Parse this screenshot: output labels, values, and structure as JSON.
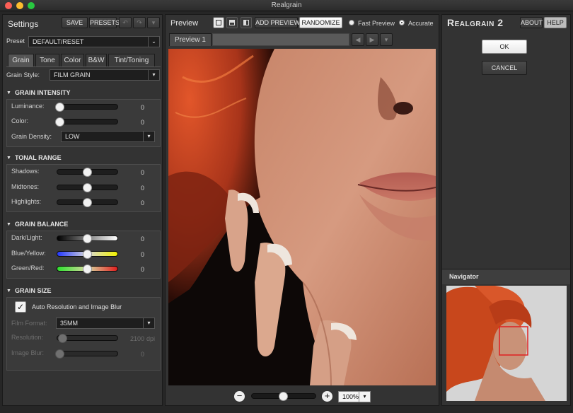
{
  "window": {
    "title": "Realgrain"
  },
  "left": {
    "title": "Settings",
    "save": "SAVE",
    "presets": "PRESETS",
    "preset_label": "Preset",
    "preset_value": "DEFAULT/RESET",
    "tabs": [
      "Grain",
      "Tone",
      "Color",
      "B&W",
      "Tint/Toning"
    ],
    "grain_style_label": "Grain Style:",
    "grain_style_value": "FILM GRAIN",
    "intensity": {
      "title": "GRAIN INTENSITY",
      "luminance_label": "Luminance:",
      "luminance": "0",
      "color_label": "Color:",
      "color": "0",
      "density_label": "Grain Density:",
      "density": "LOW"
    },
    "tonal": {
      "title": "TONAL RANGE",
      "shadows_label": "Shadows:",
      "shadows": "0",
      "midtones_label": "Midtones:",
      "midtones": "0",
      "highlights_label": "Highlights:",
      "highlights": "0"
    },
    "balance": {
      "title": "GRAIN BALANCE",
      "dl_label": "Dark/Light:",
      "dl": "0",
      "by_label": "Blue/Yellow:",
      "by": "0",
      "gr_label": "Green/Red:",
      "gr": "0"
    },
    "size": {
      "title": "GRAIN SIZE",
      "auto_label": "Auto Resolution and Image Blur",
      "film_format_label": "Film Format:",
      "film_format": "35MM",
      "resolution_label": "Resolution:",
      "resolution": "2100",
      "resolution_unit": "dpi",
      "blur_label": "Image Blur:",
      "blur": "0"
    }
  },
  "preview": {
    "title": "Preview",
    "add_preview": "ADD PREVIEW",
    "randomize": "RANDOMIZE",
    "fast_preview": "Fast Preview",
    "accurate": "Accurate",
    "tab": "Preview 1",
    "zoom": "100%"
  },
  "right": {
    "brand_big": "Realgrain",
    "brand_num": "2",
    "about": "ABOUT",
    "help": "HELP",
    "ok": "OK",
    "cancel": "CANCEL",
    "navigator": "Navigator"
  },
  "colors": {
    "accent_hair": "#c8471c"
  }
}
